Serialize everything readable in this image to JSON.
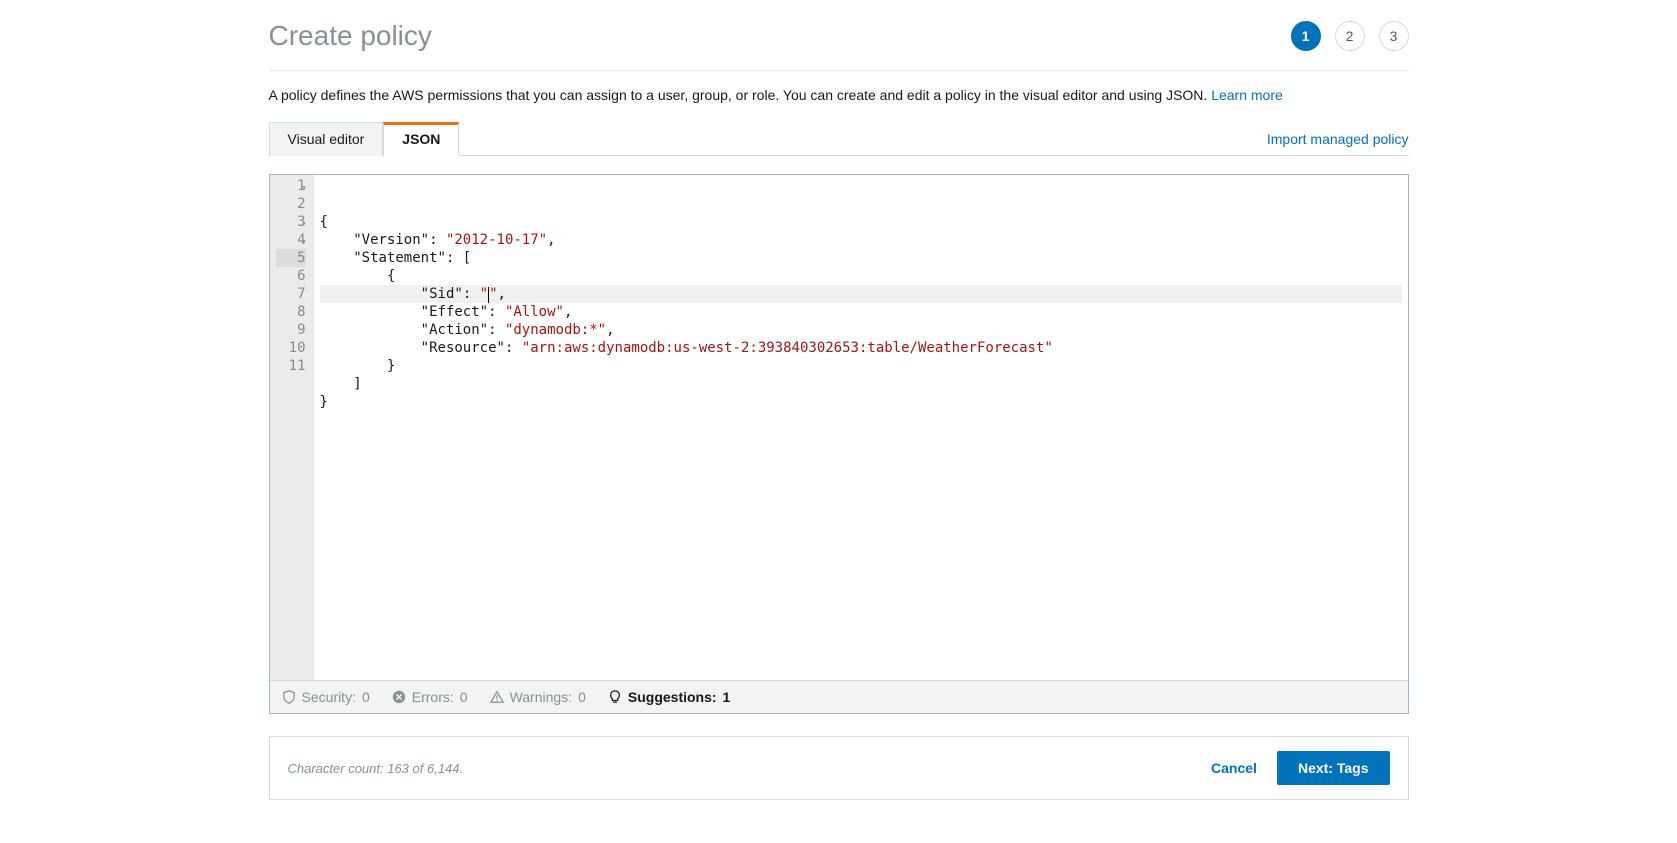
{
  "header": {
    "title": "Create policy"
  },
  "steps": {
    "items": [
      "1",
      "2",
      "3"
    ],
    "active_index": 0
  },
  "description": {
    "text": "A policy defines the AWS permissions that you can assign to a user, group, or role. You can create and edit a policy in the visual editor and using JSON. ",
    "link": "Learn more"
  },
  "tabs": {
    "visual": "Visual editor",
    "json": "JSON",
    "active": "json"
  },
  "import_link": "Import managed policy",
  "editor": {
    "line_numbers": [
      "1",
      "2",
      "3",
      "4",
      "5",
      "6",
      "7",
      "8",
      "9",
      "10",
      "11"
    ],
    "foldable": [
      0,
      2,
      3
    ],
    "highlighted_line": 4,
    "code_tokens": [
      [
        {
          "t": "punct",
          "v": "{"
        }
      ],
      [
        {
          "t": "pad",
          "v": "    "
        },
        {
          "t": "key",
          "v": "\"Version\""
        },
        {
          "t": "punct",
          "v": ": "
        },
        {
          "t": "str",
          "v": "\"2012-10-17\""
        },
        {
          "t": "punct",
          "v": ","
        }
      ],
      [
        {
          "t": "pad",
          "v": "    "
        },
        {
          "t": "key",
          "v": "\"Statement\""
        },
        {
          "t": "punct",
          "v": ": ["
        }
      ],
      [
        {
          "t": "pad",
          "v": "        "
        },
        {
          "t": "punct",
          "v": "{"
        }
      ],
      [
        {
          "t": "pad",
          "v": "            "
        },
        {
          "t": "key",
          "v": "\"Sid\""
        },
        {
          "t": "punct",
          "v": ": "
        },
        {
          "t": "str",
          "v": "\""
        },
        {
          "t": "cursor"
        },
        {
          "t": "str",
          "v": "\""
        },
        {
          "t": "punct",
          "v": ","
        }
      ],
      [
        {
          "t": "pad",
          "v": "            "
        },
        {
          "t": "key",
          "v": "\"Effect\""
        },
        {
          "t": "punct",
          "v": ": "
        },
        {
          "t": "str",
          "v": "\"Allow\""
        },
        {
          "t": "punct",
          "v": ","
        }
      ],
      [
        {
          "t": "pad",
          "v": "            "
        },
        {
          "t": "key",
          "v": "\"Action\""
        },
        {
          "t": "punct",
          "v": ": "
        },
        {
          "t": "str",
          "v": "\"dynamodb:*\""
        },
        {
          "t": "punct",
          "v": ","
        }
      ],
      [
        {
          "t": "pad",
          "v": "            "
        },
        {
          "t": "key",
          "v": "\"Resource\""
        },
        {
          "t": "punct",
          "v": ": "
        },
        {
          "t": "str",
          "v": "\"arn:aws:dynamodb:us-west-2:393840302653:table/WeatherForecast\""
        }
      ],
      [
        {
          "t": "pad",
          "v": "        "
        },
        {
          "t": "punct",
          "v": "}"
        }
      ],
      [
        {
          "t": "pad",
          "v": "    "
        },
        {
          "t": "punct",
          "v": "]"
        }
      ],
      [
        {
          "t": "punct",
          "v": "}"
        }
      ]
    ]
  },
  "status_bar": {
    "security": {
      "label": "Security:",
      "count": "0"
    },
    "errors": {
      "label": "Errors:",
      "count": "0"
    },
    "warnings": {
      "label": "Warnings:",
      "count": "0"
    },
    "suggestions": {
      "label": "Suggestions:",
      "count": "1"
    }
  },
  "footer": {
    "char_count": "Character count: 163 of 6,144.",
    "cancel": "Cancel",
    "next": "Next: Tags"
  }
}
